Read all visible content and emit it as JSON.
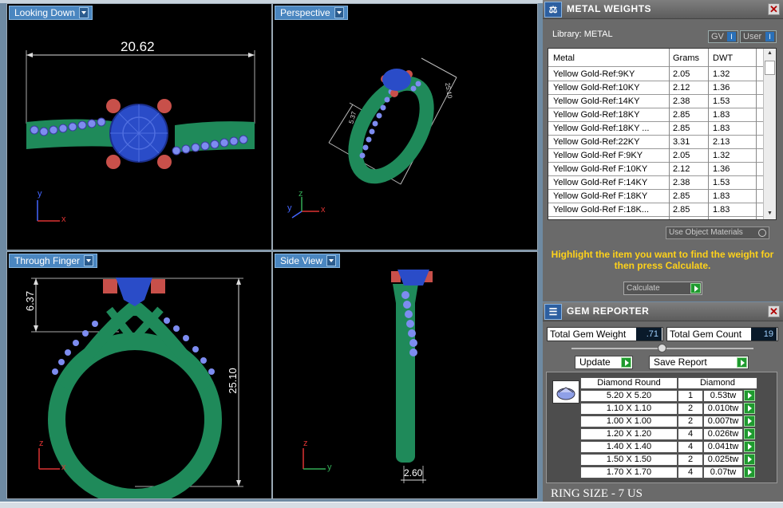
{
  "viewports": {
    "top_left": {
      "label": "Looking Down",
      "dimension": "20.62",
      "axis_a": "y",
      "axis_b": "x"
    },
    "top_right": {
      "label": "Perspective",
      "dim_small": "5.37",
      "dim_large": "25.10",
      "axis_y": "y",
      "axis_z": "z",
      "axis_x": "x"
    },
    "bottom_left": {
      "label": "Through Finger",
      "dim_height": "6.37",
      "dim_ring": "25.10",
      "axis_a": "z",
      "axis_b": "x"
    },
    "bottom_right": {
      "label": "Side View",
      "dim_width": "2.60",
      "axis_a": "z",
      "axis_b": "y"
    }
  },
  "metal_panel": {
    "title": "METAL WEIGHTS",
    "close": "✕",
    "library_label": "Library: METAL",
    "gv_label": "GV",
    "user_label": "User",
    "toggle_mark": "I",
    "columns": {
      "metal": "Metal",
      "grams": "Grams",
      "dwt": "DWT"
    },
    "rows": [
      {
        "metal": "Yellow Gold-Ref:9KY",
        "grams": "2.05",
        "dwt": "1.32"
      },
      {
        "metal": "Yellow Gold-Ref:10KY",
        "grams": "2.12",
        "dwt": "1.36"
      },
      {
        "metal": "Yellow Gold-Ref:14KY",
        "grams": "2.38",
        "dwt": "1.53"
      },
      {
        "metal": "Yellow Gold-Ref:18KY",
        "grams": "2.85",
        "dwt": "1.83"
      },
      {
        "metal": "Yellow Gold-Ref:18KY ...",
        "grams": "2.85",
        "dwt": "1.83"
      },
      {
        "metal": "Yellow Gold-Ref:22KY",
        "grams": "3.31",
        "dwt": "2.13"
      },
      {
        "metal": "Yellow Gold-Ref F:9KY",
        "grams": "2.05",
        "dwt": "1.32"
      },
      {
        "metal": "Yellow Gold-Ref F:10KY",
        "grams": "2.12",
        "dwt": "1.36"
      },
      {
        "metal": "Yellow Gold-Ref F:14KY",
        "grams": "2.38",
        "dwt": "1.53"
      },
      {
        "metal": "Yellow Gold-Ref F:18KY",
        "grams": "2.85",
        "dwt": "1.83"
      },
      {
        "metal": "Yellow Gold-Ref F:18K...",
        "grams": "2.85",
        "dwt": "1.83"
      }
    ],
    "use_object_materials": "Use Object Materials",
    "hint": "Highlight the item you want to find the weight for then press Calculate.",
    "calculate": "Calculate"
  },
  "gem_panel": {
    "title": "GEM REPORTER",
    "close": "✕",
    "total_weight_label": "Total Gem Weight",
    "total_weight_value": ".71",
    "total_count_label": "Total Gem Count",
    "total_count_value": "19",
    "update_label": "Update",
    "save_label": "Save Report",
    "shape_header": "Diamond Round",
    "material_header": "Diamond",
    "gems": [
      {
        "size": "5.20 X 5.20",
        "count": "1",
        "weight": "0.53tw"
      },
      {
        "size": "1.10 X 1.10",
        "count": "2",
        "weight": "0.010tw"
      },
      {
        "size": "1.00 X 1.00",
        "count": "2",
        "weight": "0.007tw"
      },
      {
        "size": "1.20 X 1.20",
        "count": "4",
        "weight": "0.026tw"
      },
      {
        "size": "1.40 X 1.40",
        "count": "4",
        "weight": "0.041tw"
      },
      {
        "size": "1.50 X 1.50",
        "count": "2",
        "weight": "0.025tw"
      },
      {
        "size": "1.70 X 1.70",
        "count": "4",
        "weight": "0.07tw"
      }
    ],
    "ring_size": "RING SIZE - 7 US"
  },
  "colors": {
    "metal_green": "#1f8a5a",
    "gem_blue": "#2a4cc8",
    "prong_red": "#c8504a",
    "pave_blue": "#7d8cf0",
    "hint_yellow": "#ffd21a"
  }
}
